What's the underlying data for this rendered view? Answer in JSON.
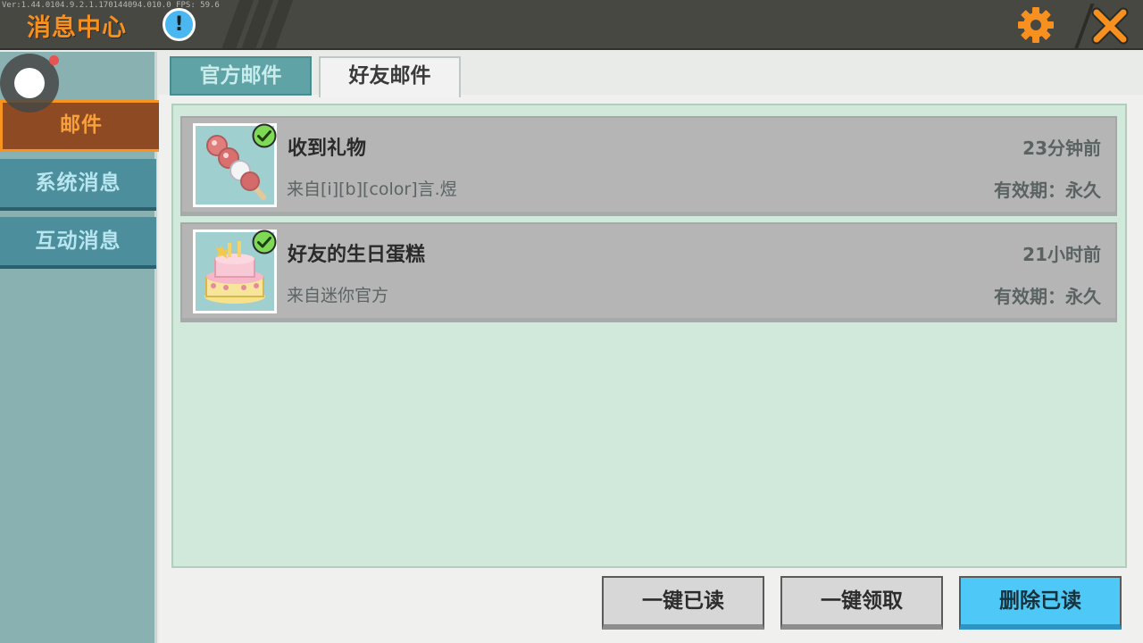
{
  "header": {
    "title": "消息中心",
    "debug_text": "Ver:1.44.0104.9.2.1.170144094.010.0 FPS: 59.6",
    "info_symbol": "!"
  },
  "sidebar": {
    "items": [
      {
        "label": "邮件",
        "active": true
      },
      {
        "label": "系统消息",
        "active": false
      },
      {
        "label": "互动消息",
        "active": false
      }
    ]
  },
  "tabs": [
    {
      "label": "官方邮件",
      "active": false
    },
    {
      "label": "好友邮件",
      "active": true
    }
  ],
  "mails": [
    {
      "title": "收到礼物",
      "from": "来自[i][b][color]言.煜",
      "time": "23分钟前",
      "expiry": "有效期：永久",
      "icon": "candied-fruit-skewer-icon",
      "claimed": true
    },
    {
      "title": "好友的生日蛋糕",
      "from": "来自迷你官方",
      "time": "21小时前",
      "expiry": "有效期：永久",
      "icon": "birthday-cake-icon",
      "claimed": true
    }
  ],
  "buttons": {
    "read_all": "一键已读",
    "claim_all": "一键领取",
    "delete_read": "删除已读"
  },
  "colors": {
    "accent_orange": "#f7901e",
    "header_bg": "#484842",
    "sidebar_bg": "#8ab1b2",
    "list_bg": "#d0e9da",
    "primary_button": "#4ec8f6"
  }
}
